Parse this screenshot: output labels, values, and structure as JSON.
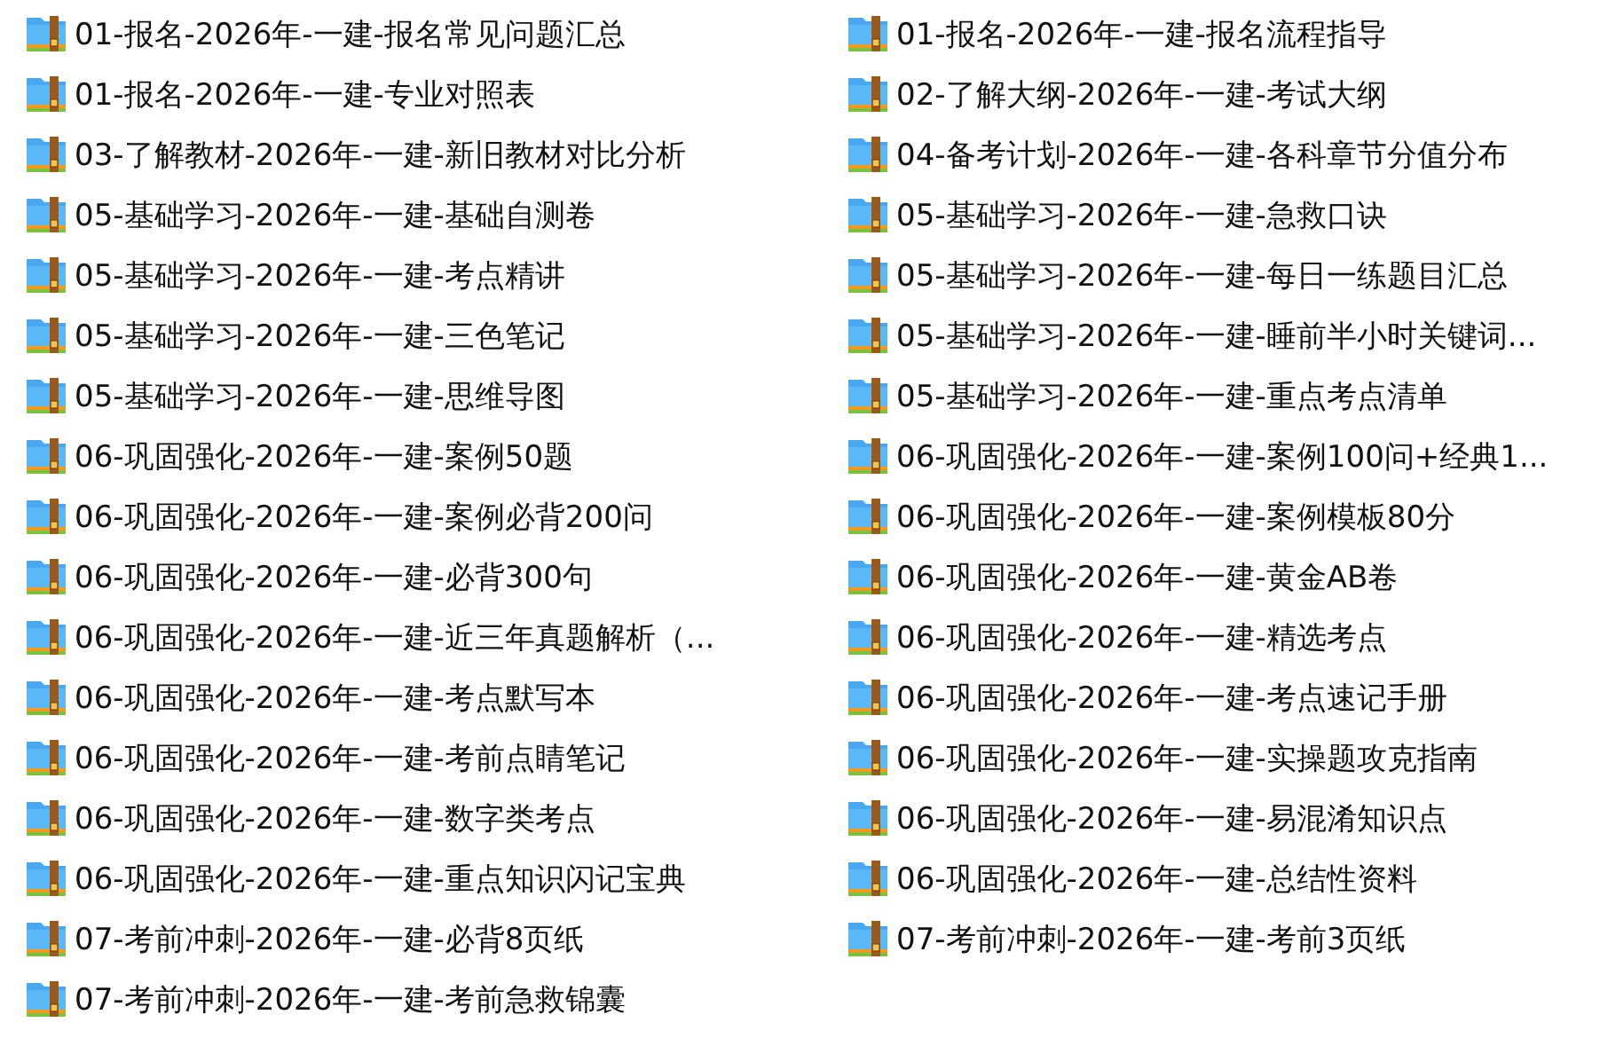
{
  "files": [
    {
      "name": "01-报名-2026年-一建-报名常见问题汇总"
    },
    {
      "name": "01-报名-2026年-一建-报名流程指导"
    },
    {
      "name": "01-报名-2026年-一建-专业对照表"
    },
    {
      "name": "02-了解大纲-2026年-一建-考试大纲"
    },
    {
      "name": "03-了解教材-2026年-一建-新旧教材对比分析"
    },
    {
      "name": "04-备考计划-2026年-一建-各科章节分值分布"
    },
    {
      "name": "05-基础学习-2026年-一建-基础自测卷"
    },
    {
      "name": "05-基础学习-2026年-一建-急救口诀"
    },
    {
      "name": "05-基础学习-2026年-一建-考点精讲"
    },
    {
      "name": "05-基础学习-2026年-一建-每日一练题目汇总"
    },
    {
      "name": "05-基础学习-2026年-一建-三色笔记"
    },
    {
      "name": "05-基础学习-2026年-一建-睡前半小时关键词..."
    },
    {
      "name": "05-基础学习-2026年-一建-思维导图"
    },
    {
      "name": "05-基础学习-2026年-一建-重点考点清单"
    },
    {
      "name": "06-巩固强化-2026年-一建-案例50题"
    },
    {
      "name": "06-巩固强化-2026年-一建-案例100问+经典1..."
    },
    {
      "name": "06-巩固强化-2026年-一建-案例必背200问"
    },
    {
      "name": "06-巩固强化-2026年-一建-案例模板80分"
    },
    {
      "name": "06-巩固强化-2026年-一建-必背300句"
    },
    {
      "name": "06-巩固强化-2026年-一建-黄金AB卷"
    },
    {
      "name": "06-巩固强化-2026年-一建-近三年真题解析（..."
    },
    {
      "name": "06-巩固强化-2026年-一建-精选考点"
    },
    {
      "name": "06-巩固强化-2026年-一建-考点默写本"
    },
    {
      "name": "06-巩固强化-2026年-一建-考点速记手册"
    },
    {
      "name": "06-巩固强化-2026年-一建-考前点睛笔记"
    },
    {
      "name": "06-巩固强化-2026年-一建-实操题攻克指南"
    },
    {
      "name": "06-巩固强化-2026年-一建-数字类考点"
    },
    {
      "name": "06-巩固强化-2026年-一建-易混淆知识点"
    },
    {
      "name": "06-巩固强化-2026年-一建-重点知识闪记宝典"
    },
    {
      "name": "06-巩固强化-2026年-一建-总结性资料"
    },
    {
      "name": "07-考前冲刺-2026年-一建-必背8页纸"
    },
    {
      "name": "07-考前冲刺-2026年-一建-考前3页纸"
    },
    {
      "name": "07-考前冲刺-2026年-一建-考前急救锦囊"
    }
  ]
}
